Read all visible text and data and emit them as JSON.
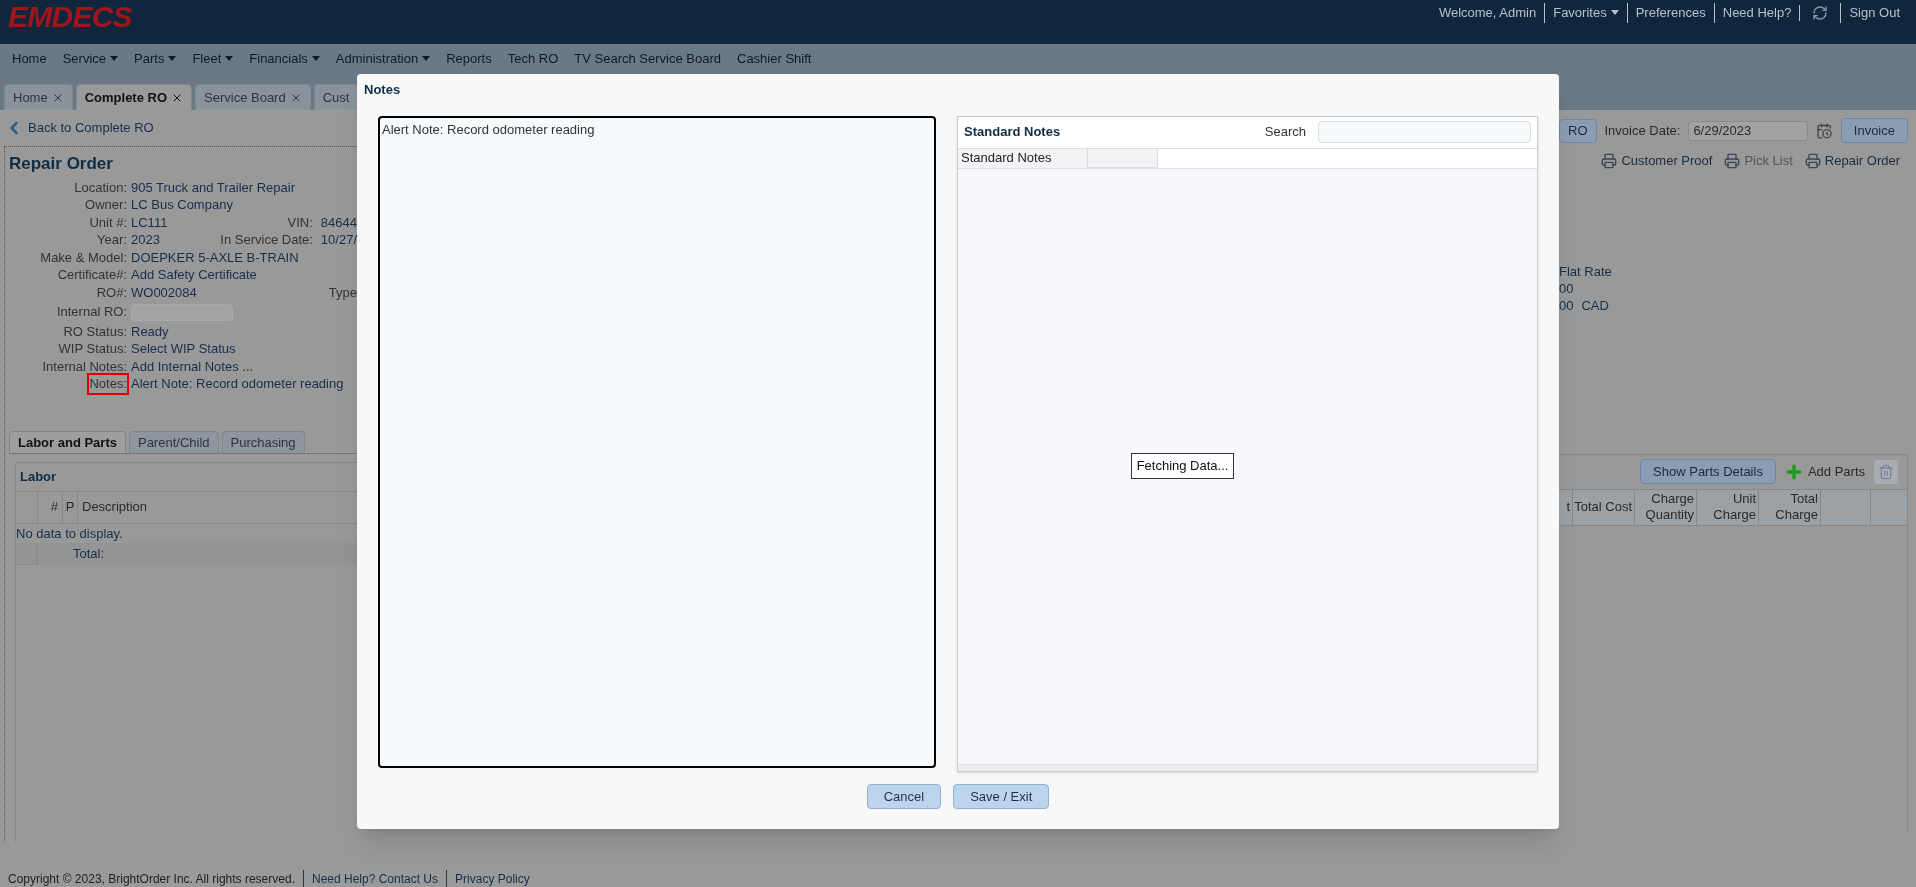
{
  "header": {
    "logo": "EMDECS",
    "links": [
      {
        "kind": "text",
        "label": "Welcome, Admin"
      },
      {
        "kind": "dropdown",
        "label": "Favorites"
      },
      {
        "kind": "text",
        "label": "Preferences"
      },
      {
        "kind": "text",
        "label": "Need Help?"
      },
      {
        "kind": "icon"
      },
      {
        "kind": "text",
        "label": "Sign Out"
      }
    ]
  },
  "menu": [
    {
      "label": "Home",
      "dropdown": false
    },
    {
      "label": "Service",
      "dropdown": true
    },
    {
      "label": "Parts",
      "dropdown": true
    },
    {
      "label": "Fleet",
      "dropdown": true
    },
    {
      "label": "Financials",
      "dropdown": true
    },
    {
      "label": "Administration",
      "dropdown": true
    },
    {
      "label": "Reports",
      "dropdown": false
    },
    {
      "label": "Tech RO",
      "dropdown": false
    },
    {
      "label": "TV Search Service Board",
      "dropdown": false
    },
    {
      "label": "Cashier Shift",
      "dropdown": false
    }
  ],
  "tabs": [
    {
      "label": "Home",
      "selected": false,
      "closable": true
    },
    {
      "label": "Complete RO",
      "selected": true,
      "closable": true
    },
    {
      "label": "Service Board",
      "selected": false,
      "closable": true
    },
    {
      "label": "Cust",
      "selected": false,
      "closable": false
    }
  ],
  "back_link": "Back to Complete RO",
  "repair_order": {
    "title": "Repair Order",
    "fields": [
      {
        "label": "Location:",
        "kind": "text",
        "value": "905 Truck and Trailer Repair",
        "highlighted": false
      },
      {
        "label": "Owner:",
        "kind": "text",
        "value": "LC Bus Company",
        "highlighted": false
      },
      {
        "label": "Unit #:",
        "kind": "text",
        "value": "LC111",
        "extra_label": "VIN:",
        "extra_value": "84644",
        "highlighted": false
      },
      {
        "label": "Year:",
        "kind": "text",
        "value": "2023",
        "extra_label": "In Service Date:",
        "extra_value": "10/27/",
        "highlighted": false
      },
      {
        "label": "Make & Model:",
        "kind": "text",
        "value": "DOEPKER 5-AXLE B-TRAIN",
        "highlighted": false
      },
      {
        "label": "Certificate#:",
        "kind": "text",
        "value": "Add Safety Certificate",
        "highlighted": false
      },
      {
        "label": "RO#:",
        "kind": "text",
        "value": "WO002084",
        "extra_label": "Type",
        "highlighted": false
      },
      {
        "label": "Internal RO:",
        "kind": "input",
        "highlighted": false
      },
      {
        "label": "RO Status:",
        "kind": "text",
        "value": "Ready",
        "highlighted": false
      },
      {
        "label": "WIP Status:",
        "kind": "text",
        "value": "Select WIP Status",
        "highlighted": false
      },
      {
        "label": "Internal Notes:",
        "kind": "text",
        "value": "Add Internal Notes ...",
        "highlighted": false
      },
      {
        "label": "Notes:",
        "kind": "text",
        "value": "Alert Note: Record odometer reading",
        "highlighted": true
      }
    ]
  },
  "detail_tabs": [
    {
      "label": "Labor and Parts",
      "selected": true
    },
    {
      "label": "Parent/Child",
      "selected": false
    },
    {
      "label": "Purchasing",
      "selected": false
    }
  ],
  "labor": {
    "title": "Labor",
    "columns": [
      "#",
      "P",
      "Description"
    ],
    "empty_text": "No data to display.",
    "total_label": "Total:"
  },
  "invoice": {
    "ro_button": "RO",
    "date_label": "Invoice Date:",
    "date_value": "6/29/2023",
    "button": "Invoice"
  },
  "print_links": [
    {
      "label": "Customer Proof",
      "disabled": false
    },
    {
      "label": "Pick List",
      "disabled": true
    },
    {
      "label": "Repair Order",
      "disabled": false
    }
  ],
  "summary": [
    {
      "value": "Flat Rate"
    },
    {
      "value": "00"
    },
    {
      "value": "00",
      "unit": "CAD"
    }
  ],
  "parts": {
    "show_details_button": "Show Parts Details",
    "add_button": "Add Parts",
    "columns": [
      "t",
      "Total Cost",
      "Charge Quantity",
      "Unit Charge",
      "Total Charge"
    ]
  },
  "footer": {
    "copyright": "Copyright © 2023, BrightOrder Inc. All rights reserved.",
    "links": [
      "Need Help? Contact Us",
      "Privacy Policy"
    ]
  },
  "dialog": {
    "title": "Notes",
    "note_text": "Alert Note: Record odometer reading",
    "panel_title": "Standard Notes",
    "search_label": "Search",
    "columns": [
      "Standard Notes"
    ],
    "loading_text": "Fetching Data...",
    "buttons": [
      "Cancel",
      "Save / Exit"
    ]
  }
}
